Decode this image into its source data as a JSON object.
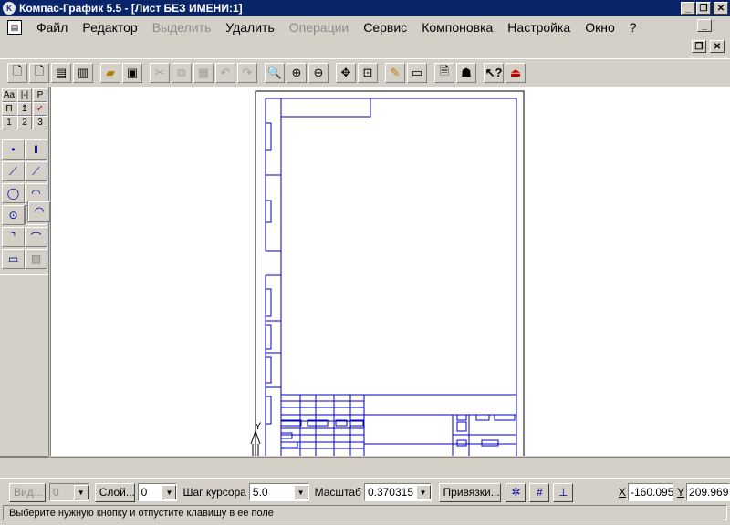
{
  "window": {
    "title": "Компас-График 5.5 - [Лист БЕЗ ИМЕНИ:1]"
  },
  "menu": {
    "items": [
      {
        "label": "Файл",
        "disabled": false
      },
      {
        "label": "Редактор",
        "disabled": false
      },
      {
        "label": "Выделить",
        "disabled": true
      },
      {
        "label": "Удалить",
        "disabled": false
      },
      {
        "label": "Операции",
        "disabled": true
      },
      {
        "label": "Сервис",
        "disabled": false
      },
      {
        "label": "Компоновка",
        "disabled": false
      },
      {
        "label": "Настройка",
        "disabled": false
      },
      {
        "label": "Окно",
        "disabled": false
      },
      {
        "label": "?",
        "disabled": false
      }
    ]
  },
  "lefttools": {
    "tab_labels": [
      "Aa",
      "|-|",
      "P",
      "П",
      "↥",
      "✓",
      "1",
      "2",
      "3"
    ]
  },
  "drawing": {
    "axis_label": "Y"
  },
  "bottom": {
    "view_btn": "Вид...",
    "view_value": "0",
    "layer_btn": "Слой...",
    "layer_value": "0",
    "cursor_step_label": "Шаг курсора",
    "cursor_step_value": "5.0",
    "scale_label": "Масштаб",
    "scale_value": "0.370315",
    "snaps_btn": "Привязки...",
    "x_label": "X",
    "x_value": "-160.095",
    "y_label": "Y",
    "y_value": "209.969"
  },
  "status": {
    "message": "Выберите нужную кнопку и отпустите клавишу в ее поле"
  }
}
